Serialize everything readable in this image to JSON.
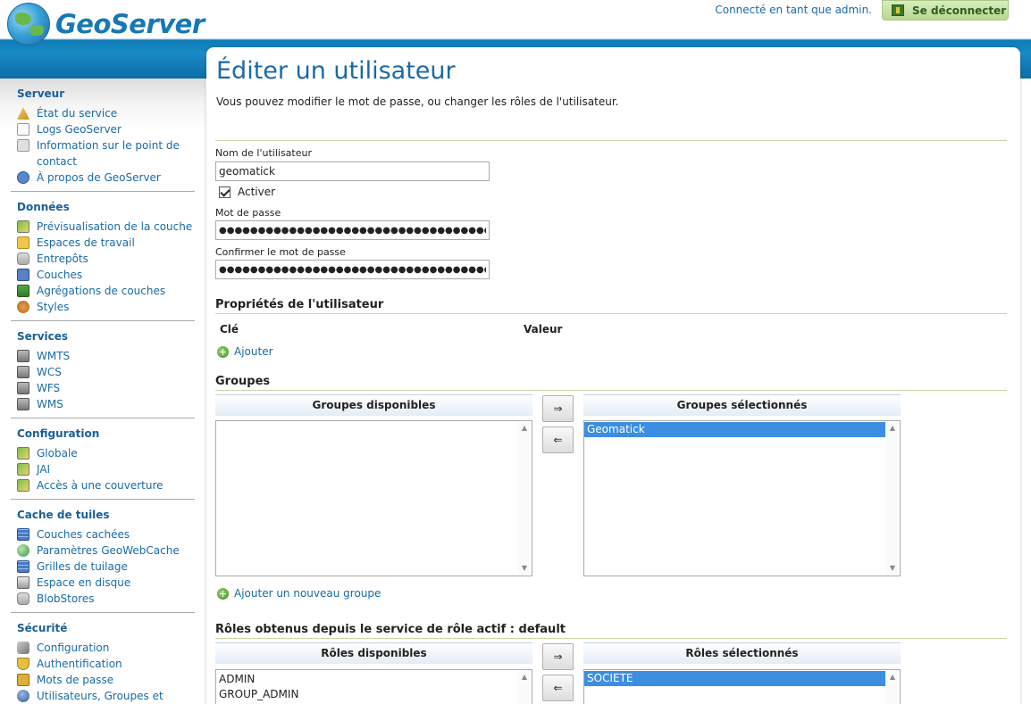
{
  "header": {
    "logo_text": "GeoServer",
    "logged_in_text": "Connecté en tant que admin.",
    "logout_label": "Se déconnecter"
  },
  "sidebar": {
    "sections": [
      {
        "title": "Serveur",
        "items": [
          {
            "label": "État du service",
            "icon": "warning-icon"
          },
          {
            "label": "Logs GeoServer",
            "icon": "document-icon"
          },
          {
            "label": "Information sur le point de contact",
            "icon": "info-icon"
          },
          {
            "label": "À propos de GeoServer",
            "icon": "help-icon"
          }
        ]
      },
      {
        "title": "Données",
        "items": [
          {
            "label": "Prévisualisation de la couche",
            "icon": "map-icon"
          },
          {
            "label": "Espaces de travail",
            "icon": "folder-icon"
          },
          {
            "label": "Entrepôts",
            "icon": "database-icon"
          },
          {
            "label": "Couches",
            "icon": "layer-icon"
          },
          {
            "label": "Agrégations de couches",
            "icon": "layer-group-icon"
          },
          {
            "label": "Styles",
            "icon": "palette-icon"
          }
        ]
      },
      {
        "title": "Services",
        "items": [
          {
            "label": "WMTS",
            "icon": "service-icon"
          },
          {
            "label": "WCS",
            "icon": "service-icon"
          },
          {
            "label": "WFS",
            "icon": "service-icon"
          },
          {
            "label": "WMS",
            "icon": "service-icon"
          }
        ]
      },
      {
        "title": "Configuration",
        "items": [
          {
            "label": "Globale",
            "icon": "global-icon"
          },
          {
            "label": "JAI",
            "icon": "jai-icon"
          },
          {
            "label": "Accès à une couverture",
            "icon": "coverage-icon"
          }
        ]
      },
      {
        "title": "Cache de tuiles",
        "items": [
          {
            "label": "Couches cachées",
            "icon": "grid-icon"
          },
          {
            "label": "Paramètres GeoWebCache",
            "icon": "globe-icon"
          },
          {
            "label": "Grilles de tuilage",
            "icon": "grid-icon"
          },
          {
            "label": "Espace en disque",
            "icon": "disk-icon"
          },
          {
            "label": "BlobStores",
            "icon": "database-icon"
          }
        ]
      },
      {
        "title": "Sécurité",
        "items": [
          {
            "label": "Configuration",
            "icon": "wrench-icon"
          },
          {
            "label": "Authentification",
            "icon": "shield-icon"
          },
          {
            "label": "Mots de passe",
            "icon": "lock-icon"
          },
          {
            "label": "Utilisateurs, Groupes et Rôles",
            "icon": "users-icon"
          }
        ]
      }
    ]
  },
  "main": {
    "title": "Éditer un utilisateur",
    "description": "Vous pouvez modifier le mot de passe, ou changer les rôles de l'utilisateur.",
    "username_label": "Nom de l'utilisateur",
    "username_value": "geomatick",
    "enable_label": "Activer",
    "enabled": true,
    "password_label": "Mot de passe",
    "password_value": "●●●●●●●●●●●●●●●●●●●●●●●●●●●●●●●●●●●●●●●●●●●●",
    "confirm_label": "Confirmer le mot de passe",
    "confirm_value": "●●●●●●●●●●●●●●●●●●●●●●●●●●●●●●●●●●●●●●●●●●●●",
    "properties": {
      "title": "Propriétés de l'utilisateur",
      "key_header": "Clé",
      "value_header": "Valeur",
      "add_label": "Ajouter"
    },
    "groups": {
      "title": "Groupes",
      "available_header": "Groupes disponibles",
      "selected_header": "Groupes sélectionnés",
      "available": [],
      "selected": [
        "Geomatick"
      ],
      "add_right": "⇒",
      "add_left": "⇐",
      "add_group_label": "Ajouter un nouveau groupe"
    },
    "roles": {
      "title": "Rôles obtenus depuis le service de rôle actif : default",
      "available_header": "Rôles disponibles",
      "selected_header": "Rôles sélectionnés",
      "available": [
        "ADMIN",
        "GROUP_ADMIN"
      ],
      "selected": [
        "SOCIETE"
      ],
      "add_right": "⇒",
      "add_left": "⇐"
    }
  },
  "colors": {
    "header_blue": "#0d7bb7",
    "link_blue": "#1a6aa5",
    "selection_blue": "#3c8ee0",
    "logout_green": "#b8d894"
  }
}
